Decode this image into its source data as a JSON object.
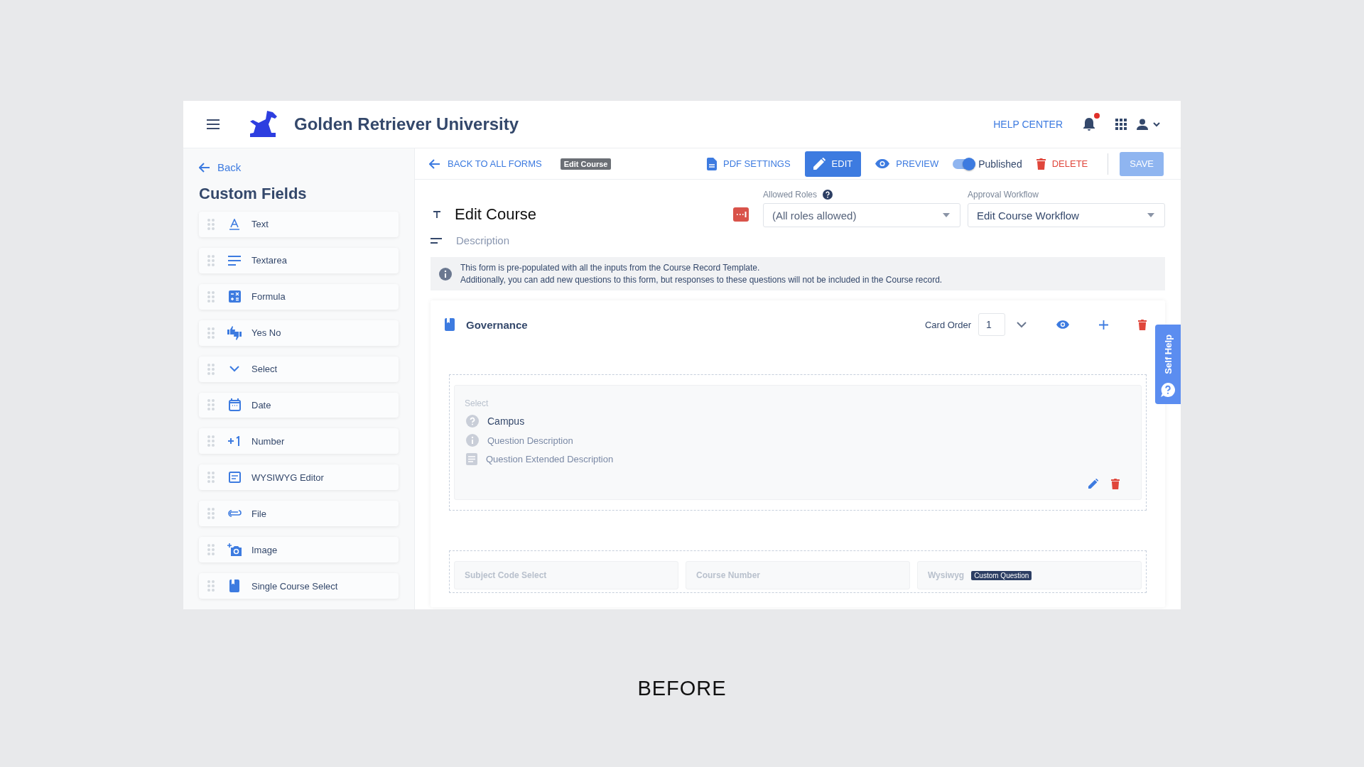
{
  "header": {
    "title": "Golden Retriever University",
    "help": "HELP CENTER",
    "notification_dot": true
  },
  "sidebar": {
    "back": "Back",
    "title": "Custom Fields",
    "items": [
      {
        "label": "Text",
        "kind": "text"
      },
      {
        "label": "Textarea",
        "kind": "textarea"
      },
      {
        "label": "Formula",
        "kind": "formula"
      },
      {
        "label": "Yes No",
        "kind": "yesno"
      },
      {
        "label": "Select",
        "kind": "select"
      },
      {
        "label": "Date",
        "kind": "date"
      },
      {
        "label": "Number",
        "kind": "number"
      },
      {
        "label": "WYSIWYG Editor",
        "kind": "wysiwyg"
      },
      {
        "label": "File",
        "kind": "file"
      },
      {
        "label": "Image",
        "kind": "image"
      },
      {
        "label": "Single Course Select",
        "kind": "course"
      }
    ]
  },
  "toolbar": {
    "back": "BACK TO ALL FORMS",
    "badge": "Edit Course",
    "actions": [
      {
        "label": "PDF SETTINGS",
        "kind": "pdf",
        "selected": false
      },
      {
        "label": "EDIT",
        "kind": "edit",
        "selected": true
      },
      {
        "label": "PREVIEW",
        "kind": "preview",
        "selected": false
      }
    ],
    "published": {
      "label": "Published",
      "on": true
    },
    "delete": "DELETE",
    "save": {
      "label": "SAVE",
      "disabled": true
    }
  },
  "form": {
    "title": "Edit Course",
    "description_placeholder": "Description",
    "allowed_roles": {
      "label": "Allowed Roles",
      "value": "(All roles allowed)"
    },
    "approval_workflow": {
      "label": "Approval Workflow",
      "value": "Edit Course Workflow"
    },
    "notice": [
      "This form is pre-populated with all the inputs from the Course Record Template.",
      "Additionally, you can add new questions to this form, but responses to these questions will not be included in the Course record."
    ]
  },
  "card": {
    "title": "Governance",
    "order_label": "Card Order",
    "order": "1",
    "question": {
      "type_label": "Select",
      "title": "Campus",
      "description": "Question Description",
      "extended": "Question Extended Description"
    },
    "next_row": [
      {
        "label": "Subject Code Select"
      },
      {
        "label": "Course Number"
      },
      {
        "label": "Wysiwyg",
        "badge": "Custom Question"
      }
    ]
  },
  "self_help": "Self Help",
  "caption": "BEFORE"
}
